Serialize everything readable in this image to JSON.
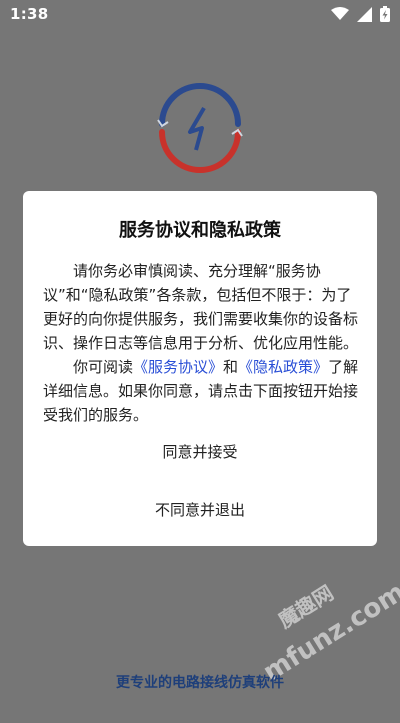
{
  "status_bar": {
    "time": "1:38"
  },
  "dialog": {
    "title": "服务协议和隐私政策",
    "para1": "请你务必审慎阅读、充分理解“服务协议”和“隐私政策”各条款，包括但不限于：为了更好的向你提供服务，我们需要收集你的设备标识、操作日志等信息用于分析、优化应用性能。",
    "para2_prefix": "你可阅读",
    "link_service": "《服务协议》",
    "para2_and": "和",
    "link_privacy": "《隐私政策》",
    "para2_suffix": "了解详细信息。如果你同意，请点击下面按钮开始接受我们的服务。",
    "accept_label": "同意并接受",
    "decline_label": "不同意并退出"
  },
  "bottom_slogan": "更专业的电路接线仿真软件",
  "watermark": {
    "cn": "魔趣网",
    "en": "mfunz.com"
  },
  "colors": {
    "overlay": "#767676",
    "link": "#2a4fd6",
    "logo_blue": "#2b4a8f",
    "logo_red": "#c8322b"
  }
}
